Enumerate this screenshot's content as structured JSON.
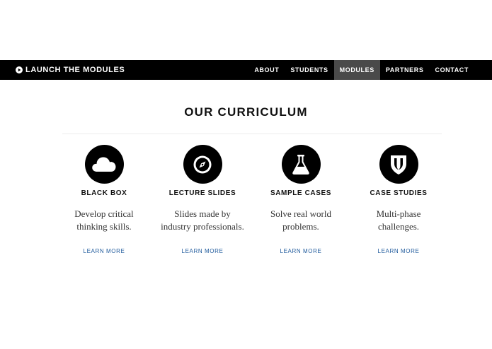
{
  "navbar": {
    "brand": "LAUNCH THE MODULES",
    "brand_icon": "play-circle-icon",
    "links": [
      {
        "label": "ABOUT",
        "active": false
      },
      {
        "label": "STUDENTS",
        "active": false
      },
      {
        "label": "MODULES",
        "active": true
      },
      {
        "label": "PARTNERS",
        "active": false
      },
      {
        "label": "CONTACT",
        "active": false
      }
    ]
  },
  "section": {
    "title": "OUR CURRICULUM"
  },
  "features": [
    {
      "icon": "cloud-icon",
      "title": "BLACK BOX",
      "desc_line1": "Develop critical",
      "desc_line2": "thinking skills.",
      "link": "LEARN MORE"
    },
    {
      "icon": "compass-icon",
      "title": "LECTURE SLIDES",
      "desc_line1": "Slides made by",
      "desc_line2": "industry professionals.",
      "link": "LEARN MORE"
    },
    {
      "icon": "flask-icon",
      "title": "SAMPLE CASES",
      "desc_line1": "Solve real world",
      "desc_line2": "problems.",
      "link": "LEARN MORE"
    },
    {
      "icon": "shield-icon",
      "title": "CASE STUDIES",
      "desc_line1": "Multi-phase",
      "desc_line2": "challenges.",
      "link": "LEARN MORE"
    }
  ],
  "colors": {
    "navbar_bg": "#000000",
    "active_tab_bg": "#4a4a4a",
    "link_color": "#1f5a9c"
  }
}
